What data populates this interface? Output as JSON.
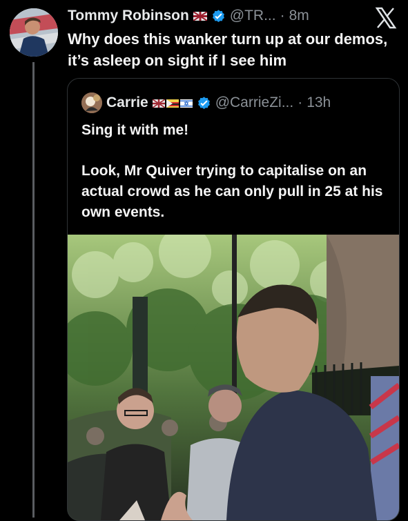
{
  "tweet": {
    "author_name": "Tommy Robinson",
    "author_flag": "uk-flag-icon",
    "handle": "@TR...",
    "separator": "·",
    "time": "8m",
    "text": "Why does this wanker turn up at our demos, it’s asleep on sight if I see him"
  },
  "quote": {
    "author_name": "Carrie",
    "flags": [
      "uk-flag-icon",
      "zimbabwe-flag-icon",
      "israel-flag-icon"
    ],
    "handle": "@CarrieZi...",
    "separator": "·",
    "time": "13h",
    "paragraphs": [
      "Sing it with me!",
      "Look, Mr Quiver trying to capitalise on an actual crowd as he can only pull in 25 at his own events."
    ]
  },
  "colors": {
    "background": "#000000",
    "text": "#e7e9ea",
    "muted": "#8b9197",
    "verified": "#1d9bf0"
  }
}
